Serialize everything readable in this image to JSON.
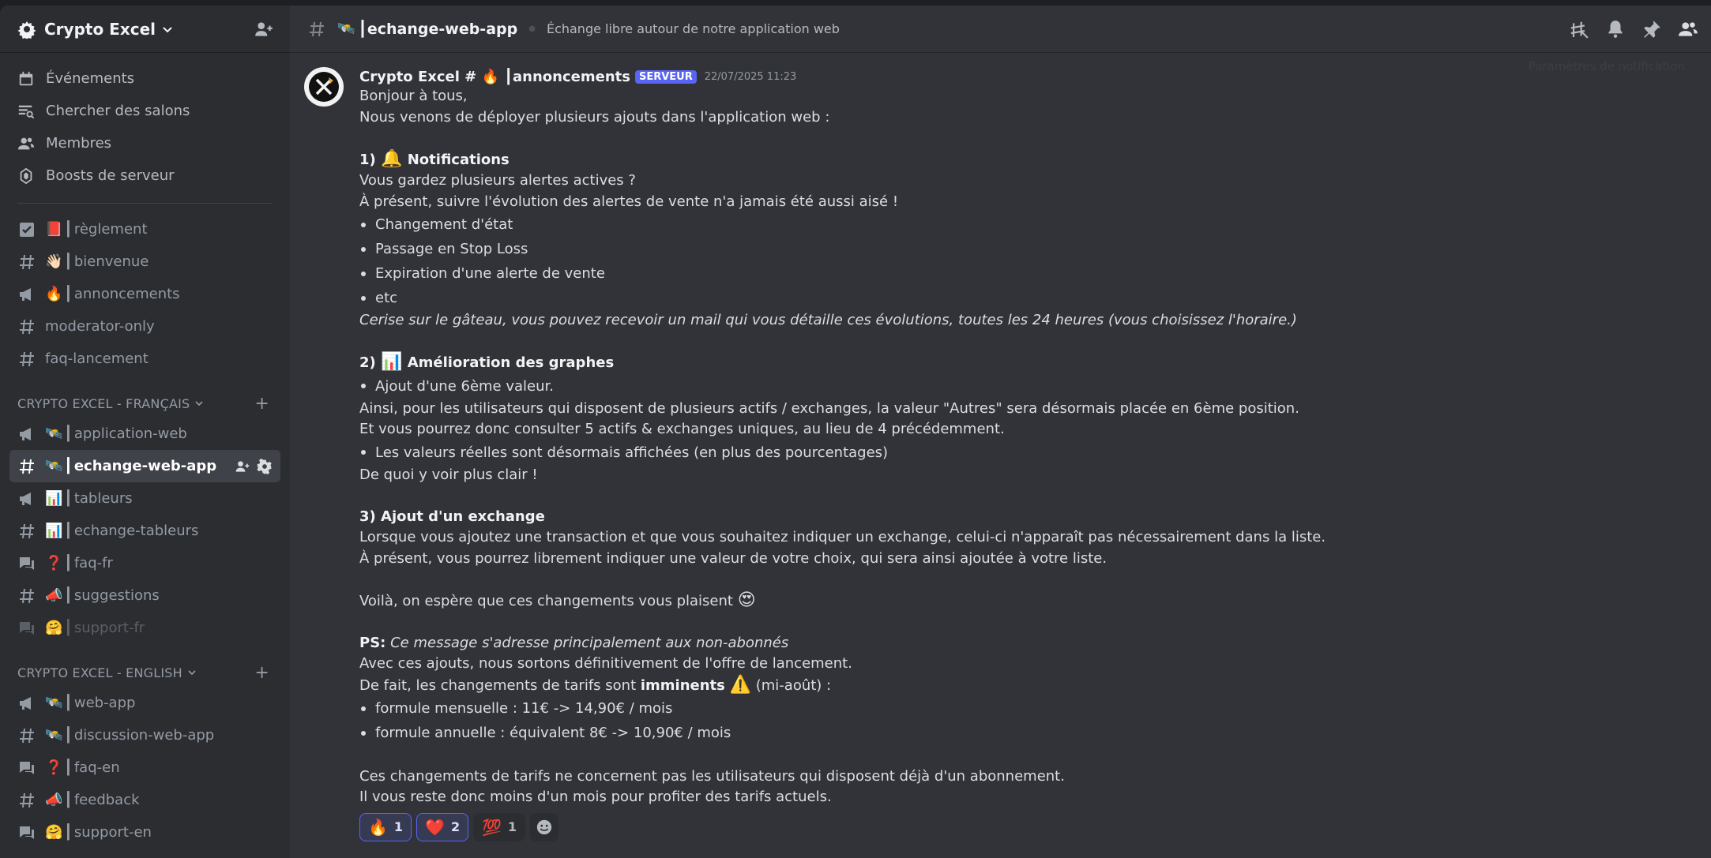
{
  "server": {
    "name": "Crypto Excel"
  },
  "nav": [
    {
      "label": "Événements",
      "icon": "calendar-icon"
    },
    {
      "label": "Chercher des salons",
      "icon": "browse-channels-icon"
    },
    {
      "label": "Membres",
      "icon": "members-icon"
    },
    {
      "label": "Boosts de serveur",
      "icon": "boost-icon"
    }
  ],
  "channels_top": [
    {
      "emoji": "📕",
      "label": "règlement",
      "icon": "rules-icon"
    },
    {
      "emoji": "👋🏻",
      "label": "bienvenue",
      "icon": "hash-icon"
    },
    {
      "emoji": "🔥",
      "label": "annoncements",
      "icon": "announcement-icon"
    },
    {
      "emoji": "",
      "label": "moderator-only",
      "icon": "hash-icon"
    },
    {
      "emoji": "",
      "label": "faq-lancement",
      "icon": "hash-icon"
    }
  ],
  "category_fr": {
    "label": "CRYPTO EXCEL - FRANÇAIS",
    "channels": [
      {
        "emoji": "🛰️",
        "label": "application-web",
        "icon": "announcement-icon"
      },
      {
        "emoji": "🛰️",
        "label": "echange-web-app",
        "icon": "hash-icon",
        "active": true
      },
      {
        "emoji": "📊",
        "label": "tableurs",
        "icon": "announcement-icon"
      },
      {
        "emoji": "📊",
        "label": "echange-tableurs",
        "icon": "hash-icon"
      },
      {
        "emoji": "❓",
        "label": "faq-fr",
        "icon": "forum-icon"
      },
      {
        "emoji": "📣",
        "label": "suggestions",
        "icon": "hash-icon"
      },
      {
        "emoji": "🤗",
        "label": "support-fr",
        "icon": "forum-icon",
        "muted": true
      }
    ]
  },
  "category_en": {
    "label": "CRYPTO EXCEL - ENGLISH",
    "channels": [
      {
        "emoji": "🛰️",
        "label": "web-app",
        "icon": "announcement-icon"
      },
      {
        "emoji": "🛰️",
        "label": "discussion-web-app",
        "icon": "hash-icon"
      },
      {
        "emoji": "❓",
        "label": "faq-en",
        "icon": "forum-icon"
      },
      {
        "emoji": "📣",
        "label": "feedback",
        "icon": "hash-icon"
      },
      {
        "emoji": "🤗",
        "label": "support-en",
        "icon": "forum-icon"
      }
    ]
  },
  "topbar": {
    "channel_emoji": "🛰️",
    "channel_name": "echange-web-app",
    "topic": "Échange libre autour de notre application web",
    "tooltip": "Paramètres de notification"
  },
  "message": {
    "author": "Crypto Excel # 🔥 ┃annoncements",
    "badge": "SERVEUR",
    "timestamp": "22/07/2025 11:23",
    "l1": "Bonjour à tous,",
    "l2": "Nous venons de déployer plusieurs ajouts dans l'application web :",
    "s1_num": "1)",
    "s1_emoji": "🔔",
    "s1_title": "Notifications",
    "s1_l1": "Vous gardez plusieurs alertes actives ?",
    "s1_l2": "À présent, suivre l'évolution des alertes de vente n'a jamais été aussi aisé !",
    "s1_bullets": [
      "Changement d'état",
      "Passage en Stop Loss",
      "Expiration d'une alerte de vente",
      "etc"
    ],
    "s1_italic": "Cerise sur le gâteau, vous pouvez recevoir un mail qui vous détaille ces évolutions, toutes les 24 heures (vous choisissez l'horaire.)",
    "s2_num": "2)",
    "s2_emoji": "📊",
    "s2_title": "Amélioration des graphes",
    "s2_b1": "Ajout d'une 6ème valeur.",
    "s2_l1": "Ainsi, pour les utilisateurs qui disposent de plusieurs actifs / exchanges, la valeur \"Autres\" sera désormais placée en 6ème position.",
    "s2_l2": "Et vous pourrez donc consulter 5 actifs & exchanges uniques, au lieu de 4 précédemment.",
    "s2_b2": "Les valeurs réelles sont désormais affichées (en plus des pourcentages)",
    "s2_l3": "De quoi y voir plus clair !",
    "s3_title": "3) Ajout d'un exchange",
    "s3_l1": "Lorsque vous ajoutez une transaction et que vous souhaitez indiquer un exchange, celui-ci n'apparaît pas nécessairement dans la liste.",
    "s3_l2": "À présent, vous pourrez librement indiquer une valeur de votre choix, qui sera ainsi ajoutée à votre liste.",
    "voila": "Voilà, on espère que ces changements vous plaisent",
    "voila_emoji": "😍",
    "ps_label": "PS:",
    "ps_italic": "Ce message s'adresse principalement aux non-abonnés",
    "ps_l1": "Avec ces ajouts, nous sortons définitivement de l'offre de lancement.",
    "ps_l2a": "De fait, les changements de tarifs sont",
    "ps_l2b": "imminents",
    "ps_l2_emoji": "⚠️",
    "ps_l2c": "(mi-août)  :",
    "ps_bullets": [
      "formule mensuelle : 11€ -> 14,90€ / mois",
      "formule annuelle : équivalent 8€ -> 10,90€ / mois"
    ],
    "end_l1": "Ces changements de tarifs ne concernent pas les utilisateurs qui disposent déjà d'un abonnement.",
    "end_l2": "Il vous reste donc moins d'un mois pour profiter des tarifs actuels."
  },
  "reactions": [
    {
      "emoji": "🔥",
      "count": "1",
      "me": true
    },
    {
      "emoji": "❤️",
      "count": "2",
      "me": true
    },
    {
      "emoji": "💯",
      "count": "1",
      "me": false
    }
  ]
}
